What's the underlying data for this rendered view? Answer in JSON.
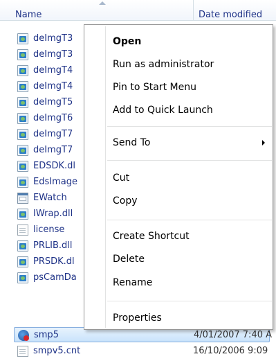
{
  "header": {
    "name_label": "Name",
    "date_label": "Date modified"
  },
  "files": [
    {
      "name": "deImgT3",
      "icon": "dll-icon",
      "date": ""
    },
    {
      "name": "deImgT3",
      "icon": "dll-icon",
      "date": ""
    },
    {
      "name": "deImgT4",
      "icon": "dll-icon",
      "date": ""
    },
    {
      "name": "deImgT4",
      "icon": "dll-icon",
      "date": ""
    },
    {
      "name": "deImgT5",
      "icon": "dll-icon",
      "date": ""
    },
    {
      "name": "deImgT6",
      "icon": "dll-icon",
      "date": ""
    },
    {
      "name": "deImgT7",
      "icon": "dll-icon",
      "date": ""
    },
    {
      "name": "deImgT7",
      "icon": "dll-icon",
      "date": ""
    },
    {
      "name": "EDSDK.dl",
      "icon": "dll-icon",
      "date": ""
    },
    {
      "name": "EdsImage",
      "icon": "dll-icon",
      "date": ""
    },
    {
      "name": "EWatch",
      "icon": "app-icon",
      "date": ""
    },
    {
      "name": "IWrap.dll",
      "icon": "dll-icon",
      "date": ""
    },
    {
      "name": "license",
      "icon": "text-file-icon",
      "date": ""
    },
    {
      "name": "PRLIB.dll",
      "icon": "dll-icon",
      "date": ""
    },
    {
      "name": "PRSDK.dl",
      "icon": "dll-icon",
      "date": ""
    },
    {
      "name": "psCamDa",
      "icon": "dll-icon",
      "date": ""
    },
    {
      "name": "smp5",
      "icon": "smp-app-icon",
      "date": "4/01/2007 7:40 A",
      "selected": true
    },
    {
      "name": "smpv5.cnt",
      "icon": "text-file-icon",
      "date": "16/10/2006 9:09"
    }
  ],
  "context_menu": {
    "open": "Open",
    "run_as_admin": "Run as administrator",
    "pin_start": "Pin to Start Menu",
    "add_quick_launch": "Add to Quick Launch",
    "send_to": "Send To",
    "cut": "Cut",
    "copy": "Copy",
    "create_shortcut": "Create Shortcut",
    "delete": "Delete",
    "rename": "Rename",
    "properties": "Properties"
  },
  "colors": {
    "file_text": "#1e3287",
    "selection_border": "#84acdd",
    "menu_border": "#979797"
  }
}
